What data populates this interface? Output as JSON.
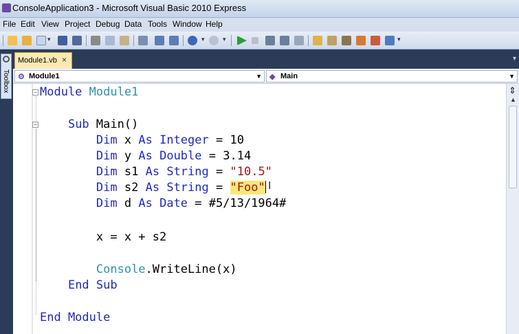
{
  "window": {
    "title": "ConsoleApplication3 - Microsoft Visual Basic 2010 Express"
  },
  "menu": [
    "File",
    "Edit",
    "View",
    "Project",
    "Debug",
    "Data",
    "Tools",
    "Window",
    "Help"
  ],
  "toolbox": {
    "label": "Toolbox"
  },
  "tab": {
    "label": "Module1.vb",
    "close": "×"
  },
  "navbar": {
    "left_combo": "Module1",
    "right_combo": "Main"
  },
  "code": {
    "l1_kw": "Module",
    "l1_name": "Module1",
    "l2_kw": "Sub",
    "l2_name": "Main()",
    "l3_dim": "Dim",
    "l3_var": "x",
    "l3_as": "As",
    "l3_type": "Integer",
    "l3_rest": "= 10",
    "l4_dim": "Dim",
    "l4_var": "y",
    "l4_as": "As",
    "l4_type": "Double",
    "l4_rest": "= 3.14",
    "l5_dim": "Dim",
    "l5_var": "s1",
    "l5_as": "As",
    "l5_type": "String",
    "l5_eq": "=",
    "l5_str": "\"10.5\"",
    "l6_dim": "Dim",
    "l6_var": "s2",
    "l6_as": "As",
    "l6_type": "String",
    "l6_eq": "=",
    "l6_str": "\"Foo\"",
    "l7_dim": "Dim",
    "l7_var": "d",
    "l7_as": "As",
    "l7_type": "Date",
    "l7_rest": "= #5/13/1964#",
    "l8": "x = x + s2",
    "l9_obj": "Console",
    "l9_call": ".WriteLine(x)",
    "l10": "End Sub",
    "l11": "End Module"
  },
  "icons": {
    "toolbar": [
      "new-project-icon",
      "open-icon",
      "add-item-icon",
      "save-icon",
      "save-all-icon",
      "cut-icon",
      "copy-icon",
      "paste-icon",
      "find-icon",
      "comment-icon",
      "uncomment-icon",
      "undo-icon",
      "redo-icon",
      "start-debugging-icon",
      "stop-icon",
      "step-into-icon",
      "step-over-icon",
      "step-out-icon",
      "solution-explorer-icon",
      "properties-icon",
      "object-browser-icon",
      "toolbox-icon",
      "extension-manager-icon"
    ]
  },
  "colors": {
    "keyword": "#1d29c6",
    "string": "#a31515",
    "type_name": "#2b91af",
    "highlight": "#fbe77a",
    "tab_active": "#fbeab4",
    "chrome": "#2b3c59"
  }
}
